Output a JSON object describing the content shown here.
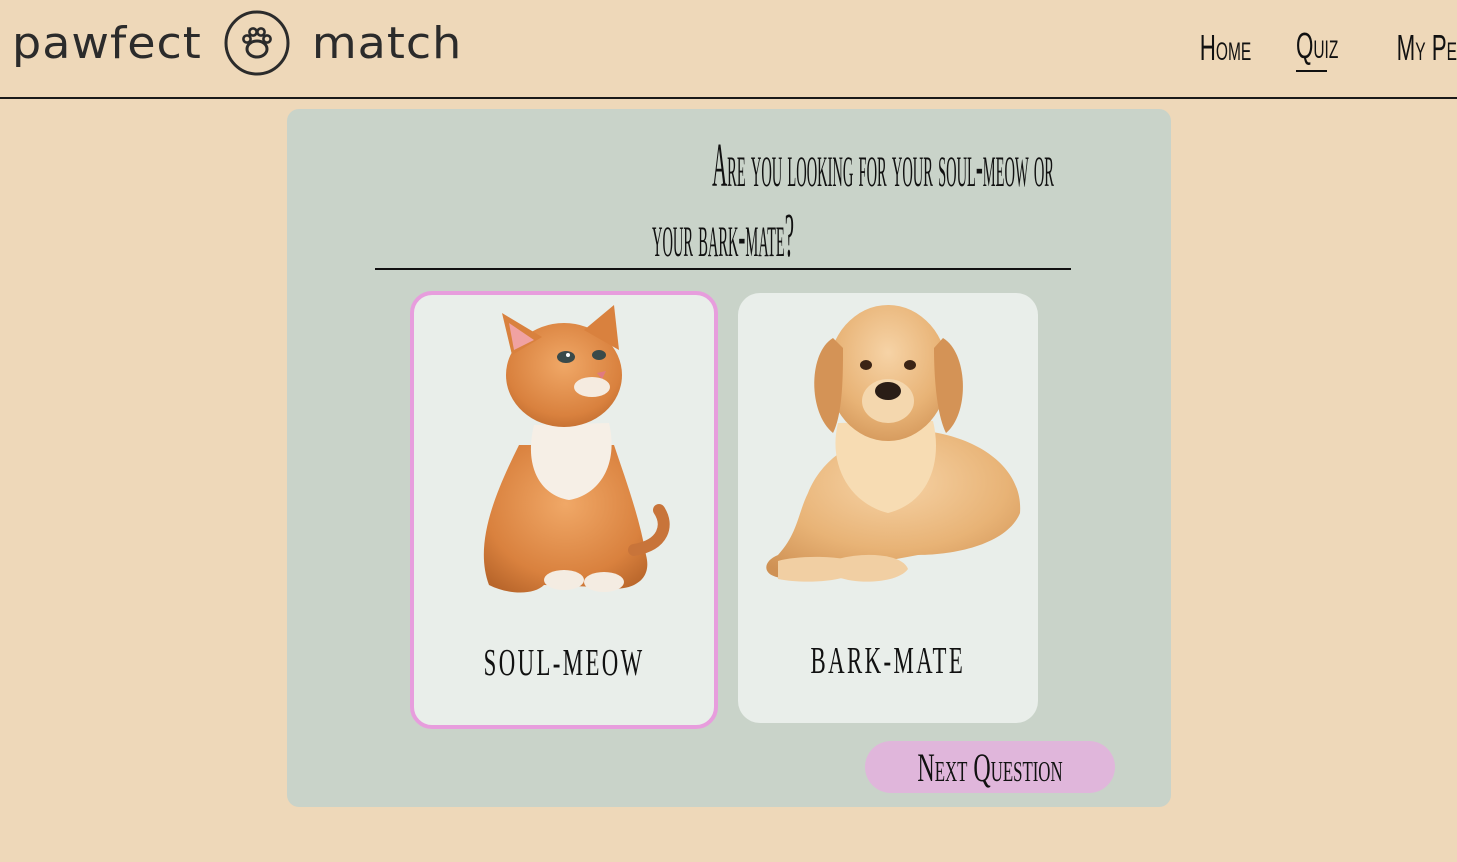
{
  "brand": {
    "name_left": "pawfect",
    "name_right": "match",
    "logo_icon": "paw-icon"
  },
  "nav": {
    "items": [
      {
        "label": "Home",
        "active": false
      },
      {
        "label": "Quiz",
        "active": true
      },
      {
        "label": "My Pets",
        "active": false
      }
    ]
  },
  "quiz": {
    "question_line1": "Are you looking for your soul-meow or",
    "question_line2": "your bark-mate?",
    "options": [
      {
        "label": "SOUL-MEOW",
        "image": "kitten-photo",
        "selected": true
      },
      {
        "label": "BARK-MATE",
        "image": "golden-retriever-photo",
        "selected": false
      }
    ],
    "next_label": "Next Question"
  },
  "colors": {
    "page_bg": "#eed8b9",
    "panel_bg": "#c9d3c9",
    "card_bg": "#e9eeea",
    "selected_border": "#e79ddd",
    "button_bg": "#e0b6db"
  }
}
